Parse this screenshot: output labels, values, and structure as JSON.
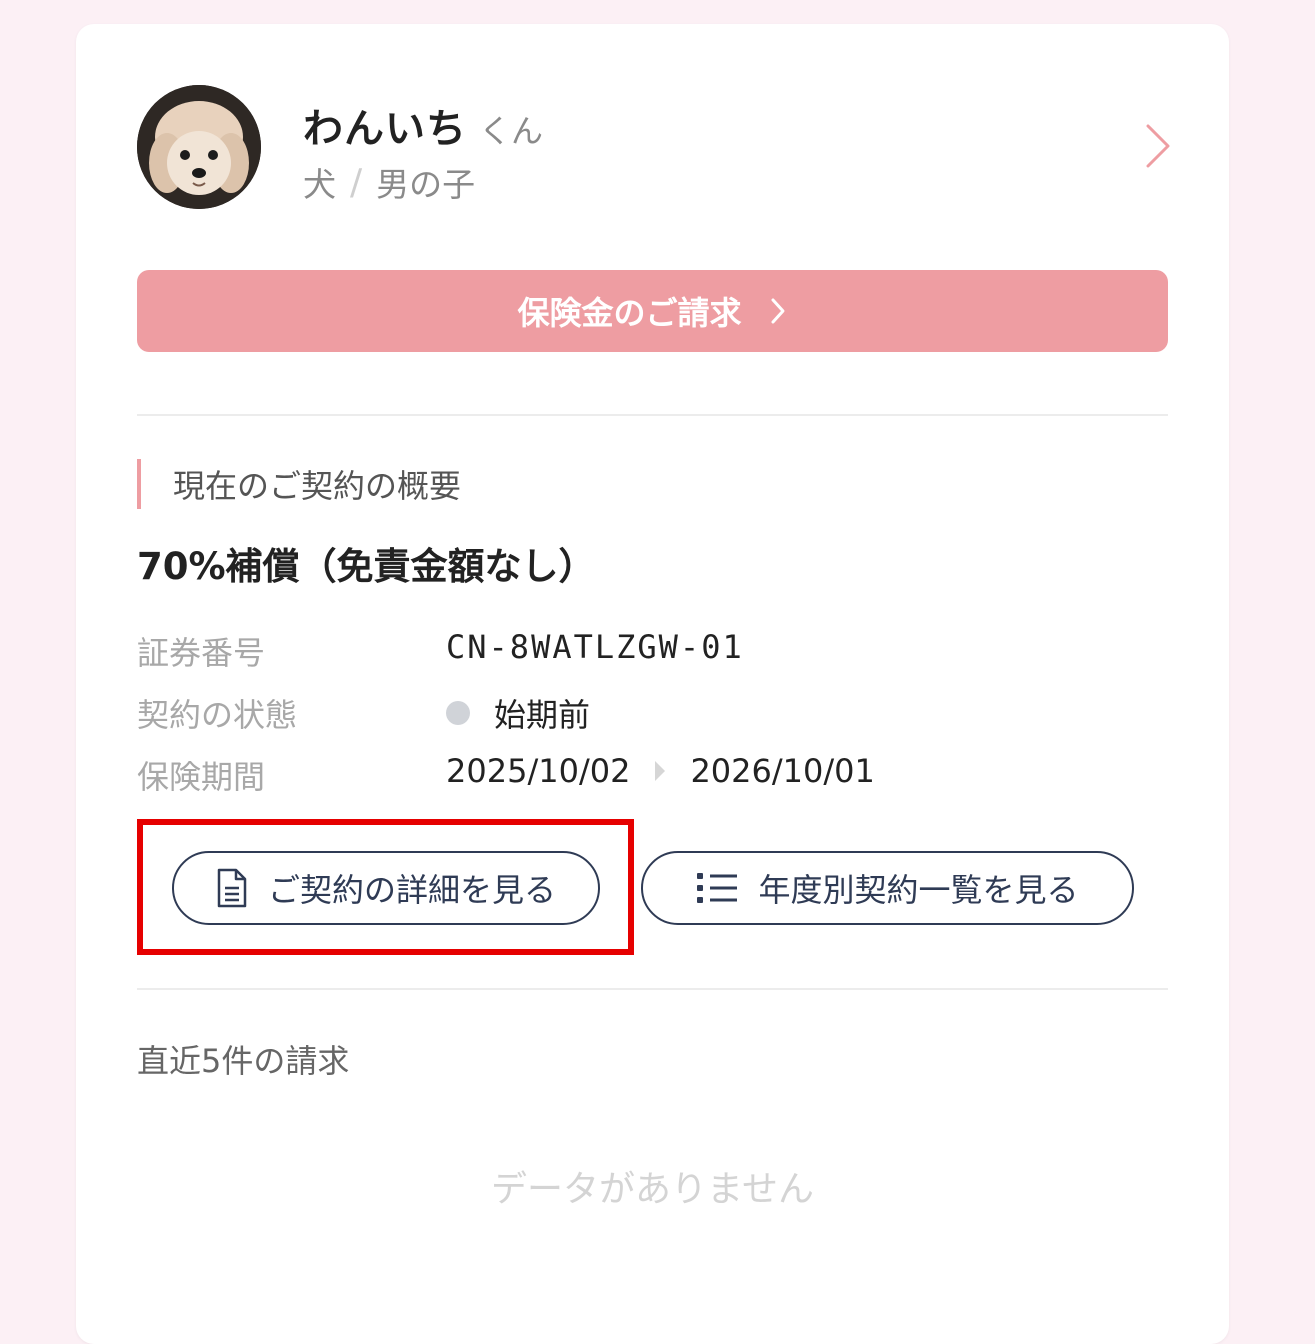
{
  "pet": {
    "name": "わんいち",
    "suffix": "くん",
    "species": "犬",
    "separator": "/",
    "gender": "男の子"
  },
  "claim_button": {
    "label": "保険金のご請求"
  },
  "contract_summary": {
    "section_title": "現在のご契約の概要",
    "plan_name": "70%補償（免責金額なし）",
    "policy_number_label": "証券番号",
    "policy_number": "CN-8WATLZGW-01",
    "status_label": "契約の状態",
    "status_value": "始期前",
    "period_label": "保険期間",
    "period_start": "2025/10/02",
    "period_end": "2026/10/01"
  },
  "actions": {
    "details_label": "ご契約の詳細を見る",
    "yearly_list_label": "年度別契約一覧を見る"
  },
  "recent_claims": {
    "title": "直近5件の請求",
    "empty_message": "データがありません"
  },
  "colors": {
    "accent_pink": "#ee9da2",
    "navy": "#2f3b55",
    "highlight_red": "#e60000",
    "page_background": "#fcf0f5"
  }
}
